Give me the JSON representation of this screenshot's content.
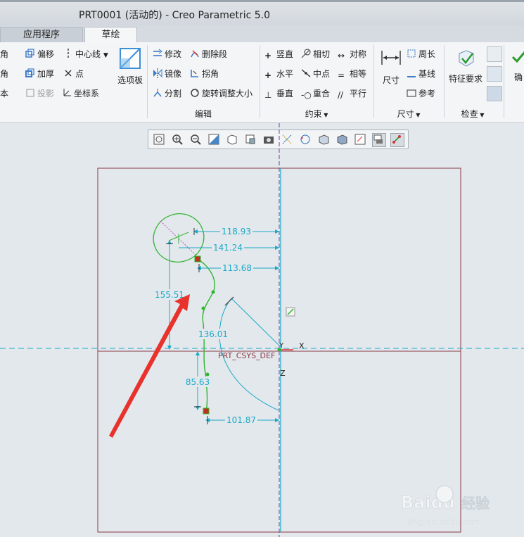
{
  "window": {
    "title": "PRT0001 (活动的) - Creo Parametric 5.0"
  },
  "tabs": [
    {
      "label": "应用程序",
      "active": false
    },
    {
      "label": "草绘",
      "active": true
    }
  ],
  "ribbon": {
    "setup_partial": {
      "items": [
        "角",
        "角",
        "本"
      ]
    },
    "col1": [
      "偏移",
      "加厚",
      "投影"
    ],
    "col2": [
      "中心线",
      "点",
      "坐标系"
    ],
    "options_button": "选项板",
    "edit": {
      "items": [
        "修改",
        "镜像",
        "分割",
        "删除段",
        "拐角",
        "旋转调整大小"
      ],
      "label": "编辑"
    },
    "constrain": {
      "items": [
        "竖直",
        "水平",
        "垂直",
        "相切",
        "中点",
        "重合",
        "对称",
        "相等",
        "平行"
      ],
      "label": "约束"
    },
    "dimension": {
      "big": "尺寸",
      "items": [
        "周长",
        "基线",
        "参考"
      ],
      "label": "尺寸"
    },
    "inspect": {
      "big": "特征要求",
      "label": "检查"
    },
    "ok_partial": "确"
  },
  "sketch": {
    "dimensions": [
      "118.93",
      "141.24",
      "113.68",
      "155.51",
      "136.01",
      "85.63",
      "101.87"
    ],
    "csys_label": "PRT_CSYS_DEF",
    "axis_labels": {
      "y": "Y",
      "x": "X",
      "z": "Z"
    }
  },
  "watermark": {
    "brand": "Baidu",
    "cn": "经验",
    "url": "jingyan.baidu.com"
  },
  "colors": {
    "dimension": "#1aa9c8",
    "sketch": "#2fb52f",
    "arrow": "#e8322b",
    "frame": "#8b3a46"
  }
}
